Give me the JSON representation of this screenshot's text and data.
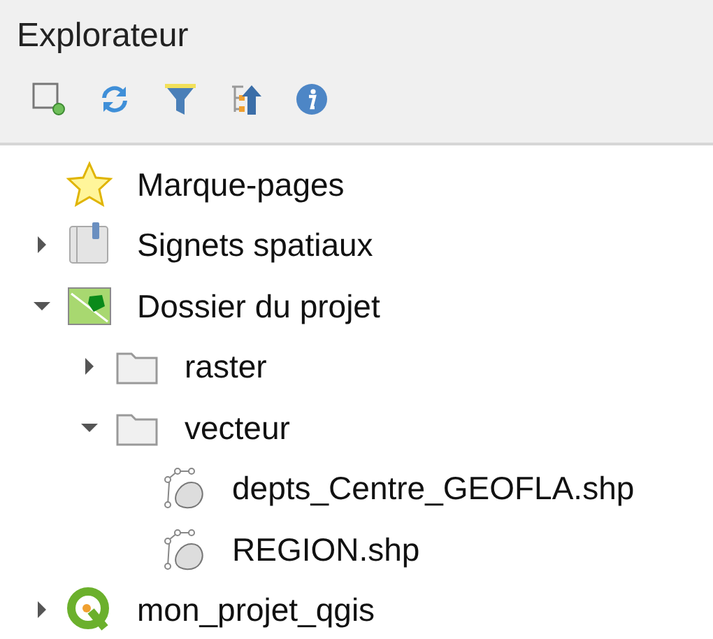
{
  "panel": {
    "title": "Explorateur"
  },
  "toolbar": [
    {
      "kind": "add"
    },
    {
      "kind": "refresh"
    },
    {
      "kind": "filter"
    },
    {
      "kind": "collapse"
    },
    {
      "kind": "info"
    }
  ],
  "tree": [
    {
      "label": "Marque-pages",
      "kind": "bookmarks"
    },
    {
      "label": "Signets spatiaux",
      "kind": "spatial",
      "expanded": false
    },
    {
      "label": "Dossier du projet",
      "kind": "project-folder",
      "expanded": true,
      "children": [
        {
          "label": "raster",
          "kind": "folder",
          "expanded": false
        },
        {
          "label": "vecteur",
          "kind": "folder",
          "expanded": true,
          "children": [
            {
              "label": "depts_Centre_GEOFLA.shp",
              "kind": "vector"
            },
            {
              "label": "REGION.shp",
              "kind": "vector"
            }
          ]
        }
      ]
    },
    {
      "label": "mon_projet_qgis",
      "kind": "qgis",
      "expanded": false
    }
  ]
}
